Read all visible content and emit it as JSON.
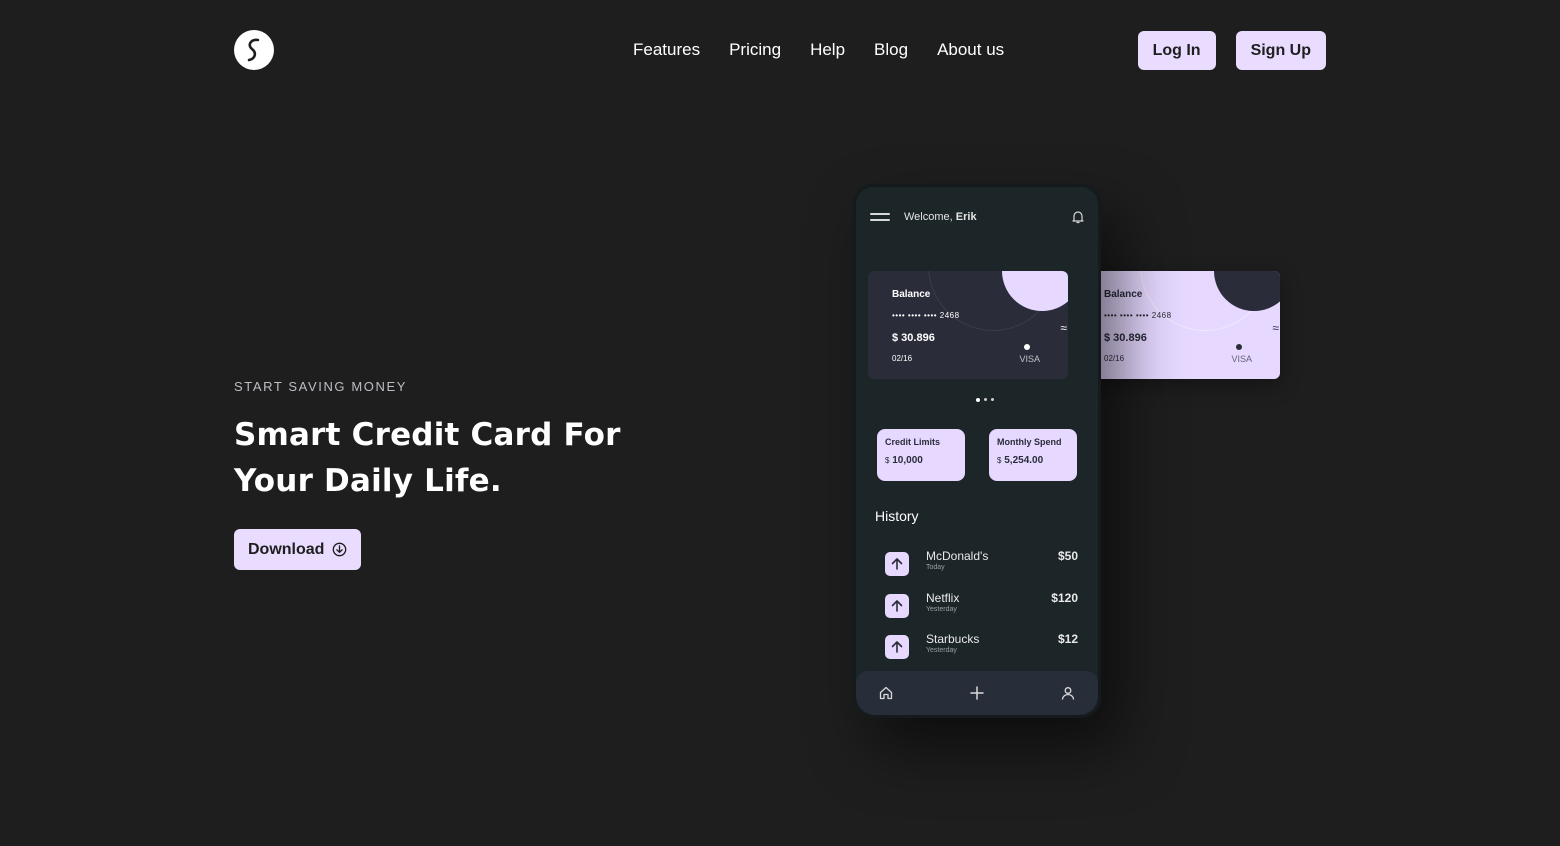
{
  "nav": {
    "links": [
      "Features",
      "Pricing",
      "Help",
      "Blog",
      "About us"
    ],
    "login": "Log In",
    "signup": "Sign Up"
  },
  "hero": {
    "eyebrow": "START SAVING MONEY",
    "headline": "Smart Credit Card For Your Daily Life.",
    "download": "Download"
  },
  "phone": {
    "welcome_prefix": "Welcome, ",
    "welcome_name": "Erik",
    "cards": [
      {
        "title": "Balance",
        "number": "•••• •••• •••• 2468",
        "balance": "$ 30.896",
        "expiry": "02/16",
        "brand": "VISA"
      },
      {
        "title": "Balance",
        "number": "•••• •••• •••• 2468",
        "balance": "$ 30.896",
        "expiry": "02/16",
        "brand": "VISA"
      }
    ],
    "stats": [
      {
        "label": "Credit Limits",
        "currency": "$",
        "value": "10,000"
      },
      {
        "label": "Monthly Spend",
        "currency": "$",
        "value": "5,254.00"
      }
    ],
    "history_title": "History",
    "history": [
      {
        "name": "McDonald's",
        "when": "Today",
        "amount": "$50"
      },
      {
        "name": "Netflix",
        "when": "Yesterday",
        "amount": "$120"
      },
      {
        "name": "Starbucks",
        "when": "Yesterday",
        "amount": "$12"
      }
    ]
  },
  "colors": {
    "background": "#1e1e1f",
    "accent": "#e9dcff",
    "phone": "#1c2528",
    "card_dark": "#2a2c3a"
  }
}
